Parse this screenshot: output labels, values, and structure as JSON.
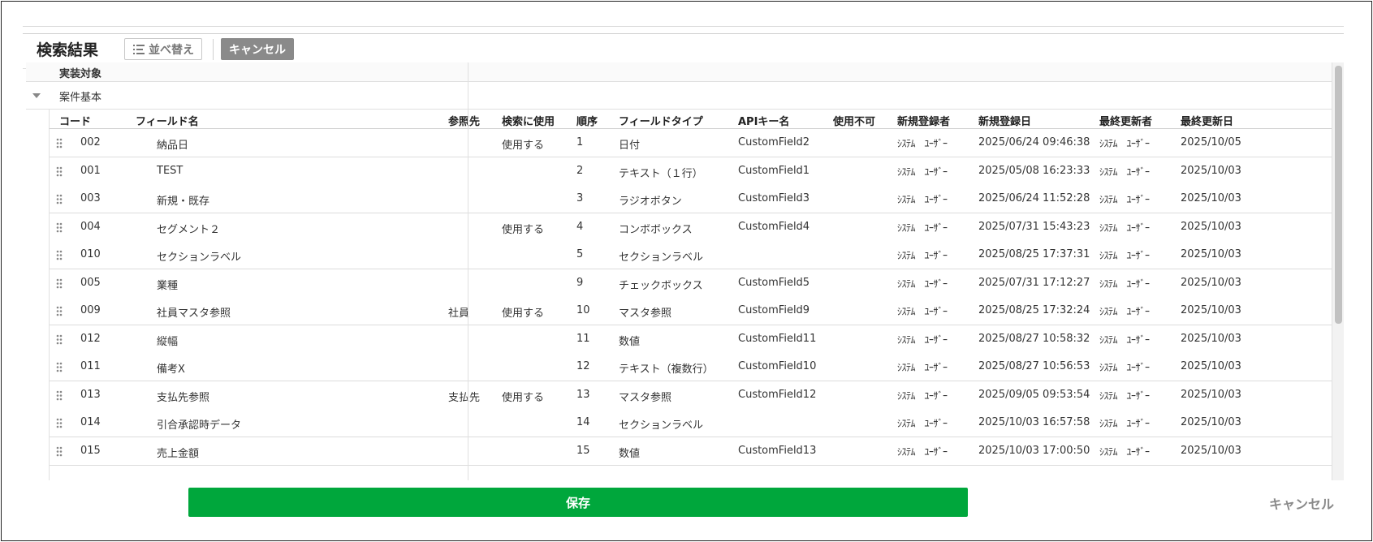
{
  "header": {
    "title": "検索結果",
    "sort_label": "並べ替え",
    "cancel_label": "キャンセル"
  },
  "group": {
    "column_title": "実装対象",
    "name": "案件基本"
  },
  "columns": {
    "code": "コード",
    "field_name": "フィールド名",
    "reference": "参照先",
    "search_use": "検索に使用",
    "order": "順序",
    "field_type": "フィールドタイプ",
    "api_key": "APIキー名",
    "disabled": "使用不可",
    "created_by": "新規登録者",
    "created_at": "新規登録日",
    "updated_by": "最終更新者",
    "updated_at": "最終更新日"
  },
  "rows": [
    {
      "code": "002",
      "name": "納品日",
      "ref": "",
      "search": "使用する",
      "order": "1",
      "type": "日付",
      "api": "CustomField2",
      "disabled": "",
      "created_by": "ｼｽﾃﾑ　ﾕｰｻﾞｰ",
      "created_at": "2025/06/24 09:46:38",
      "updated_by": "ｼｽﾃﾑ　ﾕｰｻﾞｰ",
      "updated_at": "2025/10/05"
    },
    {
      "code": "001",
      "name": "TEST",
      "ref": "",
      "search": "",
      "order": "2",
      "type": "テキスト（１行）",
      "api": "CustomField1",
      "disabled": "",
      "created_by": "ｼｽﾃﾑ　ﾕｰｻﾞｰ",
      "created_at": "2025/05/08 16:23:33",
      "updated_by": "ｼｽﾃﾑ　ﾕｰｻﾞｰ",
      "updated_at": "2025/10/03"
    },
    {
      "code": "003",
      "name": "新規・既存",
      "ref": "",
      "search": "",
      "order": "3",
      "type": "ラジオボタン",
      "api": "CustomField3",
      "disabled": "",
      "created_by": "ｼｽﾃﾑ　ﾕｰｻﾞｰ",
      "created_at": "2025/06/24 11:52:28",
      "updated_by": "ｼｽﾃﾑ　ﾕｰｻﾞｰ",
      "updated_at": "2025/10/03"
    },
    {
      "code": "004",
      "name": "セグメント２",
      "ref": "",
      "search": "使用する",
      "order": "4",
      "type": "コンボボックス",
      "api": "CustomField4",
      "disabled": "",
      "created_by": "ｼｽﾃﾑ　ﾕｰｻﾞｰ",
      "created_at": "2025/07/31 15:43:23",
      "updated_by": "ｼｽﾃﾑ　ﾕｰｻﾞｰ",
      "updated_at": "2025/10/03"
    },
    {
      "code": "010",
      "name": "セクションラベル",
      "ref": "",
      "search": "",
      "order": "5",
      "type": "セクションラベル",
      "api": "",
      "disabled": "",
      "created_by": "ｼｽﾃﾑ　ﾕｰｻﾞｰ",
      "created_at": "2025/08/25 17:37:31",
      "updated_by": "ｼｽﾃﾑ　ﾕｰｻﾞｰ",
      "updated_at": "2025/10/03"
    },
    {
      "code": "005",
      "name": "業種",
      "ref": "",
      "search": "",
      "order": "9",
      "type": "チェックボックス",
      "api": "CustomField5",
      "disabled": "",
      "created_by": "ｼｽﾃﾑ　ﾕｰｻﾞｰ",
      "created_at": "2025/07/31 17:12:27",
      "updated_by": "ｼｽﾃﾑ　ﾕｰｻﾞｰ",
      "updated_at": "2025/10/03"
    },
    {
      "code": "009",
      "name": "社員マスタ参照",
      "ref": "社員",
      "search": "使用する",
      "order": "10",
      "type": "マスタ参照",
      "api": "CustomField9",
      "disabled": "",
      "created_by": "ｼｽﾃﾑ　ﾕｰｻﾞｰ",
      "created_at": "2025/08/25 17:32:24",
      "updated_by": "ｼｽﾃﾑ　ﾕｰｻﾞｰ",
      "updated_at": "2025/10/03"
    },
    {
      "code": "012",
      "name": "縦幅",
      "ref": "",
      "search": "",
      "order": "11",
      "type": "数値",
      "api": "CustomField11",
      "disabled": "",
      "created_by": "ｼｽﾃﾑ　ﾕｰｻﾞｰ",
      "created_at": "2025/08/27 10:58:32",
      "updated_by": "ｼｽﾃﾑ　ﾕｰｻﾞｰ",
      "updated_at": "2025/10/03"
    },
    {
      "code": "011",
      "name": "備考X",
      "ref": "",
      "search": "",
      "order": "12",
      "type": "テキスト（複数行）",
      "api": "CustomField10",
      "disabled": "",
      "created_by": "ｼｽﾃﾑ　ﾕｰｻﾞｰ",
      "created_at": "2025/08/27 10:56:53",
      "updated_by": "ｼｽﾃﾑ　ﾕｰｻﾞｰ",
      "updated_at": "2025/10/03"
    },
    {
      "code": "013",
      "name": "支払先参照",
      "ref": "支払先",
      "search": "使用する",
      "order": "13",
      "type": "マスタ参照",
      "api": "CustomField12",
      "disabled": "",
      "created_by": "ｼｽﾃﾑ　ﾕｰｻﾞｰ",
      "created_at": "2025/09/05 09:53:54",
      "updated_by": "ｼｽﾃﾑ　ﾕｰｻﾞｰ",
      "updated_at": "2025/10/03"
    },
    {
      "code": "014",
      "name": "引合承認時データ",
      "ref": "",
      "search": "",
      "order": "14",
      "type": "セクションラベル",
      "api": "",
      "disabled": "",
      "created_by": "ｼｽﾃﾑ　ﾕｰｻﾞｰ",
      "created_at": "2025/10/03 16:57:58",
      "updated_by": "ｼｽﾃﾑ　ﾕｰｻﾞｰ",
      "updated_at": "2025/10/03"
    },
    {
      "code": "015",
      "name": "売上金額",
      "ref": "",
      "search": "",
      "order": "15",
      "type": "数値",
      "api": "CustomField13",
      "disabled": "",
      "created_by": "ｼｽﾃﾑ　ﾕｰｻﾞｰ",
      "created_at": "2025/10/03 17:00:50",
      "updated_by": "ｼｽﾃﾑ　ﾕｰｻﾞｰ",
      "updated_at": "2025/10/03"
    }
  ],
  "footer": {
    "save_label": "保存",
    "cancel_label": "キャンセル"
  },
  "colors": {
    "save_button": "#00a73c",
    "cancel_button": "#8a8a8a"
  },
  "icons": {
    "sort": "sort-list-icon",
    "drag": "drag-handle-icon",
    "expand": "caret-down-icon"
  }
}
